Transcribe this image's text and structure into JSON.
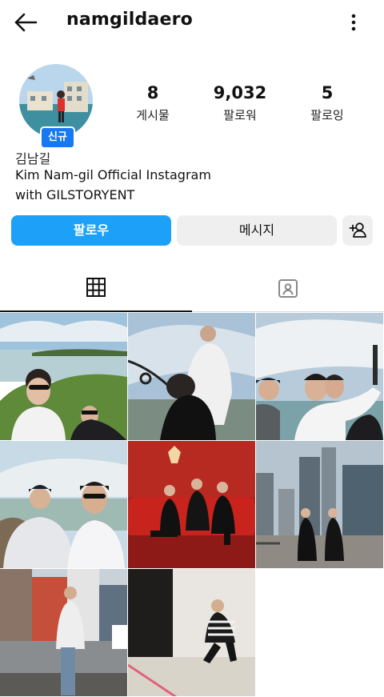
{
  "header": {
    "username": "namgildaero",
    "back_icon": "arrow-left-icon",
    "more_icon": "more-vertical-icon"
  },
  "profile": {
    "badge": "신규",
    "name": "김남길",
    "bio_line1": "Kim Nam-gil Official Instagram",
    "bio_line2": "with GILSTORYENT",
    "stats": {
      "posts": {
        "value": "8",
        "label": "게시물"
      },
      "followers": {
        "value": "9,032",
        "label": "팔로워"
      },
      "following": {
        "value": "5",
        "label": "팔로잉"
      }
    }
  },
  "actions": {
    "follow_label": "팔로우",
    "message_label": "메시지",
    "add_icon": "add-person-icon"
  },
  "tabs": [
    {
      "name": "posts-grid",
      "icon": "grid-icon",
      "active": true
    },
    {
      "name": "tagged",
      "icon": "tagged-person-icon",
      "active": false
    }
  ],
  "posts": [
    {
      "subject": "selfie at waterfront lake"
    },
    {
      "subject": "man leaning on railing under sky"
    },
    {
      "subject": "group selfie at waterfalls"
    },
    {
      "subject": "two men selfie at waterfalls"
    },
    {
      "subject": "three men on red sofa"
    },
    {
      "subject": "two men in black suits by skyscrapers"
    },
    {
      "subject": "man on city street"
    },
    {
      "subject": "man seated in photo studio"
    }
  ],
  "colors": {
    "follow_button": "#1da1f8",
    "badge": "#1877f2",
    "secondary_button": "#efefef"
  }
}
